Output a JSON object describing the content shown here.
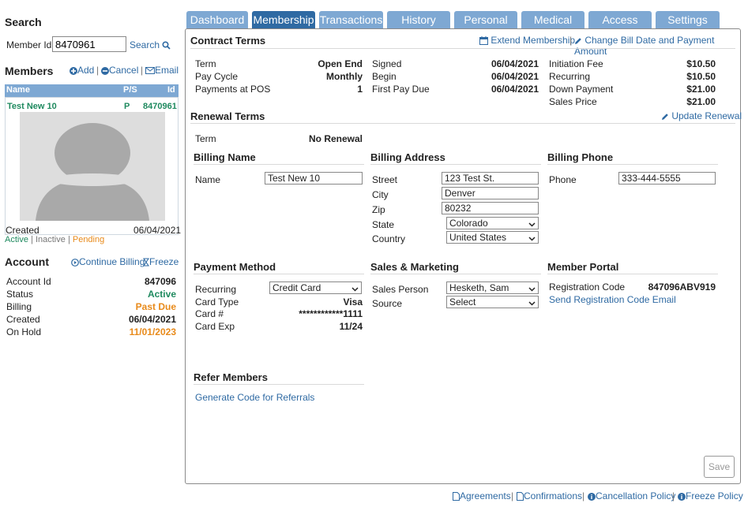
{
  "search": {
    "title": "Search",
    "member_id_label": "Member Id",
    "member_id_value": "8470961",
    "button": "Search"
  },
  "members": {
    "title": "Members",
    "add": "Add",
    "cancel": "Cancel",
    "email": "Email",
    "columns": [
      "Name",
      "P/S",
      "Id"
    ],
    "row": {
      "name": "Test New 10",
      "ps": "P",
      "id": "8470961"
    },
    "created_label": "Created",
    "created_value": "06/04/2021",
    "filter_active": "Active",
    "filter_inactive": "Inactive",
    "filter_pending": "Pending"
  },
  "account": {
    "title": "Account",
    "continue_billing": "Continue Billing",
    "freeze": "Freeze",
    "rows": [
      {
        "label": "Account Id",
        "value": "847096"
      },
      {
        "label": "Status",
        "value": "Active"
      },
      {
        "label": "Billing",
        "value": "Past Due"
      },
      {
        "label": "Created",
        "value": "06/04/2021"
      },
      {
        "label": "On Hold",
        "value": "11/01/2023"
      }
    ]
  },
  "tabs": [
    "Dashboard",
    "Membership",
    "Transactions",
    "History",
    "Personal",
    "Medical",
    "Access",
    "Settings"
  ],
  "contract": {
    "title": "Contract Terms",
    "extend": "Extend Membership",
    "change_bill": "Change Bill Date and Payment Amount",
    "term_label": "Term",
    "term_value": "Open End",
    "pay_cycle_label": "Pay Cycle",
    "pay_cycle_value": "Monthly",
    "payments_pos_label": "Payments at POS",
    "payments_pos_value": "1",
    "signed_label": "Signed",
    "signed_value": "06/04/2021",
    "begin_label": "Begin",
    "begin_value": "06/04/2021",
    "first_due_label": "First Pay Due",
    "first_due_value": "06/04/2021",
    "init_fee_label": "Initiation Fee",
    "init_fee_value": "$10.50",
    "recurring_label": "Recurring",
    "recurring_value": "$10.50",
    "down_label": "Down Payment",
    "down_value": "$21.00",
    "sales_price_label": "Sales Price",
    "sales_price_value": "$21.00"
  },
  "renewal": {
    "title": "Renewal Terms",
    "update": "Update Renewal",
    "term_label": "Term",
    "term_value": "No Renewal"
  },
  "billing_name": {
    "title": "Billing Name",
    "name_label": "Name",
    "name_value": "Test New 10"
  },
  "billing_address": {
    "title": "Billing Address",
    "street_label": "Street",
    "street_value": "123 Test St.",
    "city_label": "City",
    "city_value": "Denver",
    "zip_label": "Zip",
    "zip_value": "80232",
    "state_label": "State",
    "state_value": "Colorado",
    "country_label": "Country",
    "country_value": "United States"
  },
  "billing_phone": {
    "title": "Billing Phone",
    "phone_label": "Phone",
    "phone_value": "333-444-5555"
  },
  "payment": {
    "title": "Payment Method",
    "recurring_label": "Recurring",
    "recurring_value": "Credit Card",
    "card_type_label": "Card Type",
    "card_type_value": "Visa",
    "card_num_label": "Card #",
    "card_num_value": "************1111",
    "card_exp_label": "Card Exp",
    "card_exp_value": "11/24"
  },
  "sales": {
    "title": "Sales & Marketing",
    "person_label": "Sales Person",
    "person_value": "Hesketh, Sam",
    "source_label": "Source",
    "source_value": "Select"
  },
  "portal": {
    "title": "Member Portal",
    "reg_label": "Registration Code",
    "reg_value": "847096ABV919",
    "send_link": "Send Registration Code Email"
  },
  "refer": {
    "title": "Refer Members",
    "generate": "Generate Code for Referrals"
  },
  "save": "Save",
  "footer": {
    "agreements": "Agreements",
    "confirmations": "Confirmations",
    "cancellation": "Cancellation Policy",
    "freeze": "Freeze Policy"
  },
  "colors": {
    "tab": "#7ea8d3",
    "tab_active": "#2f6aa3",
    "link": "#2f6aa3",
    "green": "#1f8a5f",
    "orange": "#e88a1a"
  }
}
